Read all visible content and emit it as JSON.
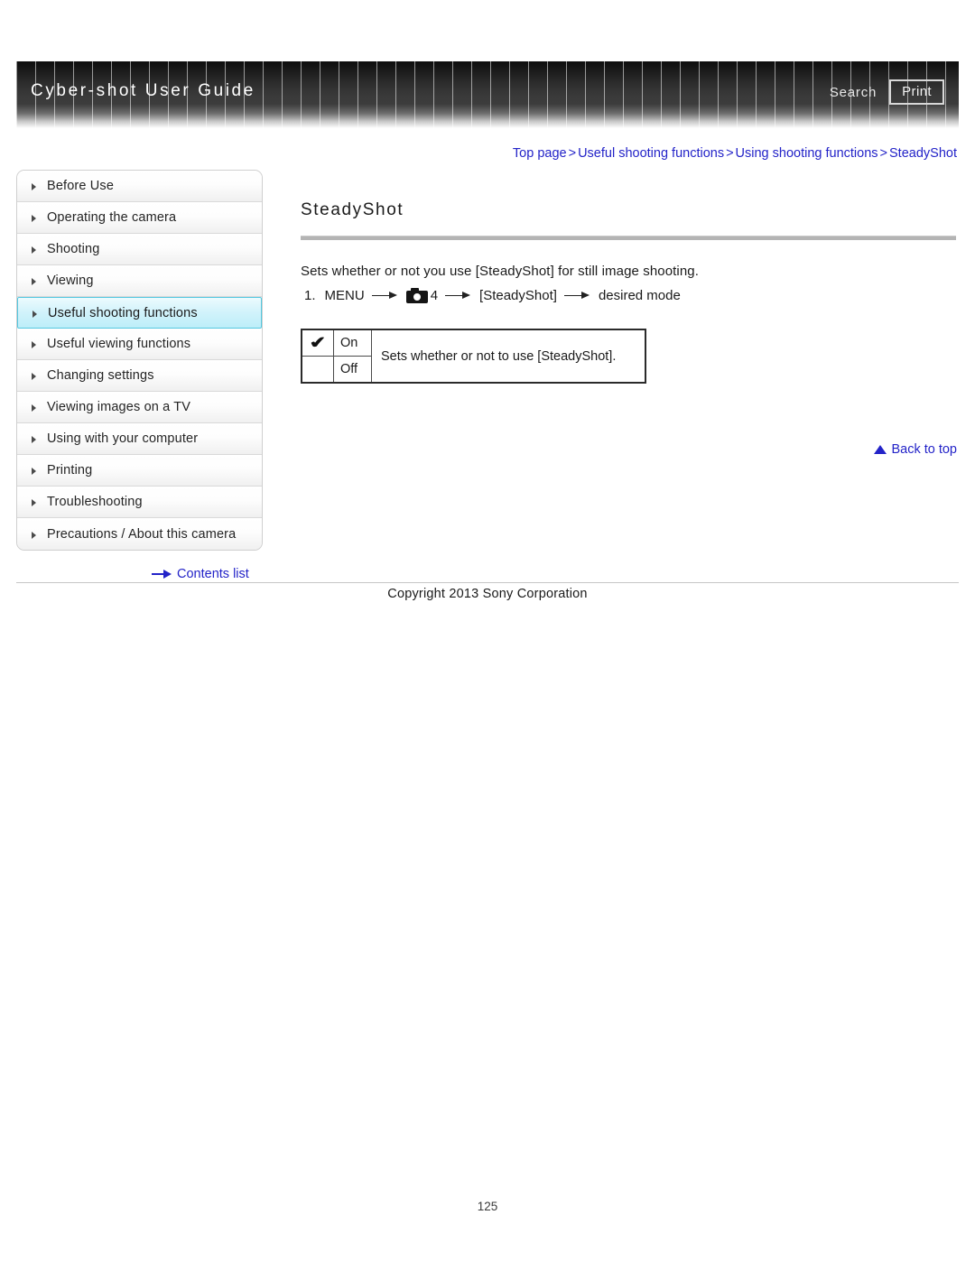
{
  "header": {
    "title": "Cyber-shot User Guide",
    "search_label": "Search",
    "print_label": "Print"
  },
  "breadcrumb": {
    "separator": ">",
    "items": [
      {
        "label": "Top page"
      },
      {
        "label": "Useful shooting functions"
      },
      {
        "label": "Using shooting functions"
      },
      {
        "label": "SteadyShot"
      }
    ]
  },
  "sidebar": {
    "items": [
      {
        "label": "Before Use",
        "active": false
      },
      {
        "label": "Operating the camera",
        "active": false
      },
      {
        "label": "Shooting",
        "active": false
      },
      {
        "label": "Viewing",
        "active": false
      },
      {
        "label": "Useful shooting functions",
        "active": true
      },
      {
        "label": "Useful viewing functions",
        "active": false
      },
      {
        "label": "Changing settings",
        "active": false
      },
      {
        "label": "Viewing images on a TV",
        "active": false
      },
      {
        "label": "Using with your computer",
        "active": false
      },
      {
        "label": "Printing",
        "active": false
      },
      {
        "label": "Troubleshooting",
        "active": false
      },
      {
        "label": "Precautions / About this camera",
        "active": false
      }
    ],
    "contents_list_label": "Contents list"
  },
  "main": {
    "title": "SteadyShot",
    "intro": "Sets whether or not you use [SteadyShot] for still image shooting.",
    "step": {
      "number": "1.",
      "menu_label": "MENU",
      "camera_icon": "camera-icon",
      "menu_tab": "4",
      "setting": "[SteadyShot]",
      "result": "desired mode"
    },
    "options_table": {
      "rows": [
        {
          "checked": "✔",
          "value": "On"
        },
        {
          "checked": "",
          "value": "Off"
        }
      ],
      "description": "Sets whether or not to use [SteadyShot]."
    },
    "back_to_top_label": "Back to top"
  },
  "footer": {
    "copyright": "Copyright 2013 Sony Corporation",
    "page_number": "125"
  },
  "colors": {
    "link": "#2323c8",
    "active_nav_bg": "#bdeef9",
    "active_nav_border": "#54c8e0",
    "banner_dark": "#1b1b1b"
  }
}
